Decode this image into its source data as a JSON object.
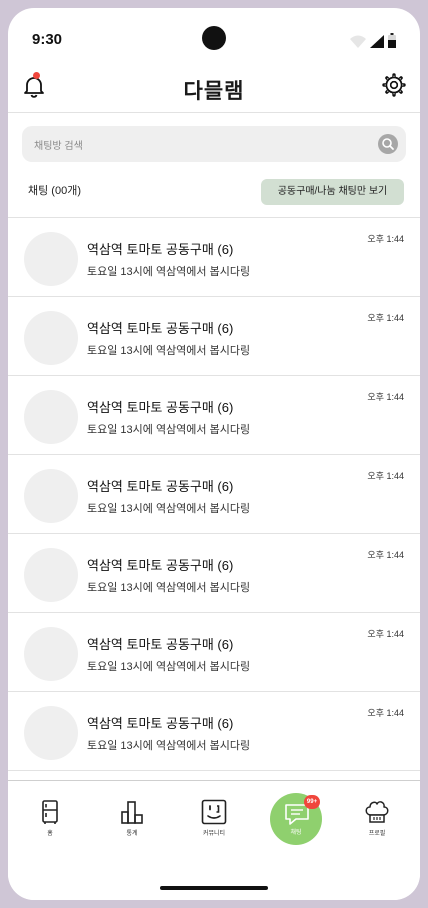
{
  "status_bar": {
    "time": "9:30"
  },
  "header": {
    "app_name": "다믈램",
    "has_notification": true
  },
  "search": {
    "placeholder": "채팅방 검색"
  },
  "list_header": {
    "count_label": "채팅 (00개)",
    "filter_button": "공동구매/나눔 채팅만 보기"
  },
  "chats": [
    {
      "title": "역삼역 토마토 공동구매 (6)",
      "preview": "토요일 13시에 역삼역에서 봅시다링",
      "time": "오후 1:44"
    },
    {
      "title": "역삼역 토마토 공동구매 (6)",
      "preview": "토요일 13시에 역삼역에서 봅시다링",
      "time": "오후 1:44"
    },
    {
      "title": "역삼역 토마토 공동구매 (6)",
      "preview": "토요일 13시에 역삼역에서 봅시다링",
      "time": "오후 1:44"
    },
    {
      "title": "역삼역 토마토 공동구매 (6)",
      "preview": "토요일 13시에 역삼역에서 봅시다링",
      "time": "오후 1:44"
    },
    {
      "title": "역삼역 토마토 공동구매 (6)",
      "preview": "토요일 13시에 역삼역에서 봅시다링",
      "time": "오후 1:44"
    },
    {
      "title": "역삼역 토마토 공동구매 (6)",
      "preview": "토요일 13시에 역삼역에서 봅시다링",
      "time": "오후 1:44"
    },
    {
      "title": "역삼역 토마토 공동구매 (6)",
      "preview": "토요일 13시에 역삼역에서 봅시다링",
      "time": "오후 1:44"
    }
  ],
  "bottom_nav": {
    "home": {
      "label": "홈",
      "icon": "fridge-icon"
    },
    "stats": {
      "label": "통계",
      "icon": "bar-chart-icon"
    },
    "community": {
      "label": "커뮤니티",
      "icon": "smile-face-icon"
    },
    "chat": {
      "label": "채팅",
      "icon": "chat-bubble-icon",
      "badge": "99+",
      "active": true
    },
    "profile": {
      "label": "프로필",
      "icon": "chef-hat-icon"
    }
  },
  "colors": {
    "accent_green": "#8fd06e",
    "filter_bg": "#d2dfd2",
    "badge_red": "#f0463c"
  }
}
